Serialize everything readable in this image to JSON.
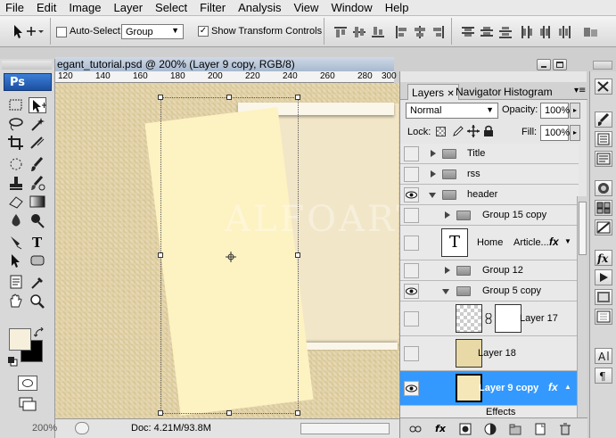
{
  "menu": [
    "File",
    "Edit",
    "Image",
    "Layer",
    "Select",
    "Filter",
    "Analysis",
    "View",
    "Window",
    "Help"
  ],
  "options": {
    "auto_select_label": "Auto-Select:",
    "auto_select_value": "Group",
    "show_transform_label": "Show Transform Controls",
    "auto_select_checked": false,
    "show_transform_checked": true
  },
  "document": {
    "title": "egant_tutorial.psd @ 200% (Layer 9 copy, RGB/8)",
    "ruler_ticks": [
      "120",
      "140",
      "160",
      "180",
      "200",
      "220",
      "240",
      "260",
      "280",
      "300"
    ],
    "watermark": "ALFOART",
    "zoom": "200%",
    "doc_size": "Doc: 4.21M/93.8M"
  },
  "tools": {
    "logo": "Ps"
  },
  "layers_panel": {
    "tabs": [
      "Layers",
      "Navigator",
      "Histogram"
    ],
    "blend_mode": "Normal",
    "opacity_label": "Opacity:",
    "opacity_value": "100%",
    "lock_label": "Lock:",
    "fill_label": "Fill:",
    "fill_value": "100%",
    "rows": [
      {
        "name": "Title",
        "type": "group",
        "visible": false,
        "expanded": false,
        "indent": 0
      },
      {
        "name": "rss",
        "type": "group",
        "visible": false,
        "expanded": false,
        "indent": 0
      },
      {
        "name": "header",
        "type": "group",
        "visible": true,
        "expanded": true,
        "indent": 0
      },
      {
        "name": "Group 15 copy",
        "type": "group",
        "visible": false,
        "expanded": false,
        "indent": 1
      },
      {
        "name": "Home",
        "type": "text",
        "extra": "Article...",
        "visible": false,
        "fx": true
      },
      {
        "name": "Group 12",
        "type": "group",
        "visible": false,
        "expanded": false,
        "indent": 1
      },
      {
        "name": "Group 5 copy",
        "type": "group",
        "visible": true,
        "expanded": true,
        "indent": 1
      },
      {
        "name": "Layer 17",
        "type": "masked",
        "visible": false
      },
      {
        "name": "Layer 18",
        "type": "pixel",
        "visible": false
      },
      {
        "name": "Layer 9 copy",
        "type": "pixel",
        "visible": true,
        "selected": true,
        "fx": true
      },
      {
        "name": "Effects",
        "type": "effects"
      }
    ],
    "fx_label": "fx"
  },
  "colors": {
    "accent": "#3b8fe8",
    "selected_row": "#3399ff",
    "canvas_base": "#e0cf9f"
  }
}
